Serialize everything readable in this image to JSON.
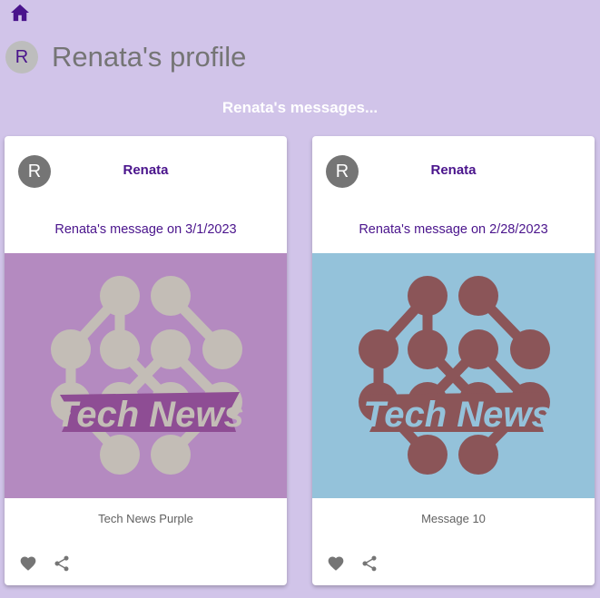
{
  "nav": {
    "home_icon": "home-icon"
  },
  "profile": {
    "avatar_letter": "R",
    "title": "Renata's profile"
  },
  "messages_heading": "Renata's messages...",
  "colors": {
    "background": "#d1c4e9",
    "accent": "#4a148c",
    "card_1_image_bg": "#b48ac0",
    "card_1_logo": "#c3bdb6",
    "card_1_ribbon": "#8e4d94",
    "card_2_image_bg": "#94c2da",
    "card_2_logo": "#8b5558",
    "card_2_ribbon": "#8b5558"
  },
  "cards": [
    {
      "avatar_letter": "R",
      "author": "Renata",
      "subtitle": "Renata's message on 3/1/2023",
      "image_text": "Tech News",
      "caption": "Tech News Purple",
      "actions": [
        "favorite-icon",
        "share-icon"
      ]
    },
    {
      "avatar_letter": "R",
      "author": "Renata",
      "subtitle": "Renata's message on 2/28/2023",
      "image_text": "Tech News",
      "caption": "Message 10",
      "actions": [
        "favorite-icon",
        "share-icon"
      ]
    }
  ]
}
